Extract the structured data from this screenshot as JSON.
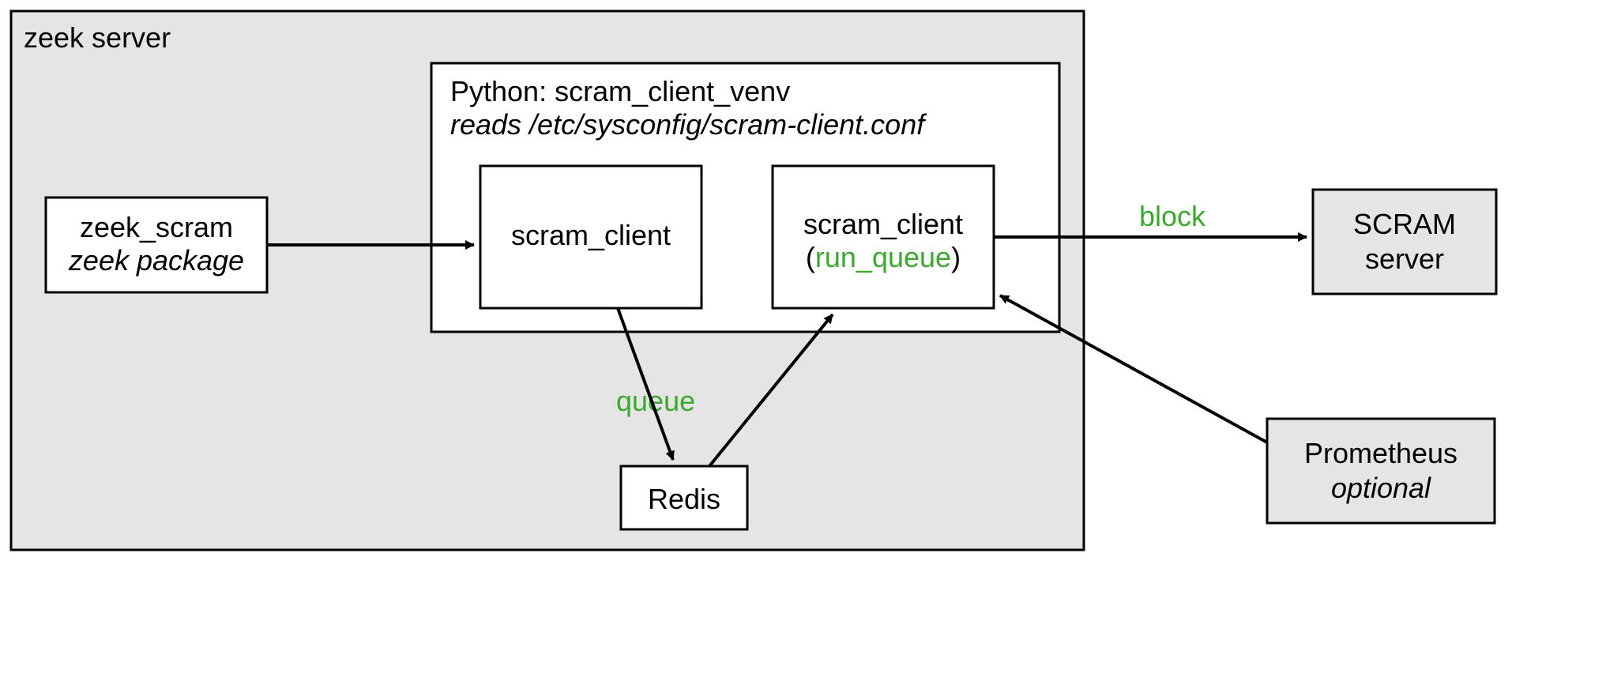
{
  "zeek_server": {
    "title": "zeek server",
    "zeek_scram": {
      "title": "zeek_scram",
      "subtitle": "zeek package"
    },
    "python_env": {
      "title": "Python: scram_client_venv",
      "subtitle": "reads /etc/sysconfig/scram-client.conf",
      "scram_client_left": "scram_client",
      "scram_client_right": "scram_client",
      "run_queue_prefix": "(",
      "run_queue": "run_queue",
      "run_queue_suffix": ")"
    },
    "redis": "Redis",
    "queue_label": "queue"
  },
  "scram_server": {
    "line1": "SCRAM",
    "line2": "server"
  },
  "prometheus": {
    "line1": "Prometheus",
    "line2": "optional"
  },
  "block_label": "block"
}
